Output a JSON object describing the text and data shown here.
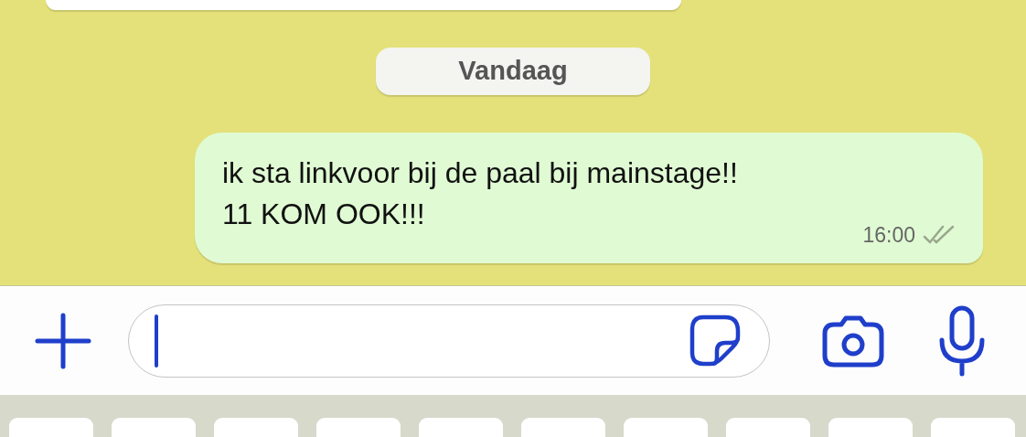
{
  "date_separator": "Vandaag",
  "messages": [
    {
      "text": "ik sta linkvoor bij de paal bij mainstage!!\n11 KOM OOK!!!",
      "time": "16:00",
      "read": false
    }
  ],
  "composer": {
    "focused": true
  }
}
